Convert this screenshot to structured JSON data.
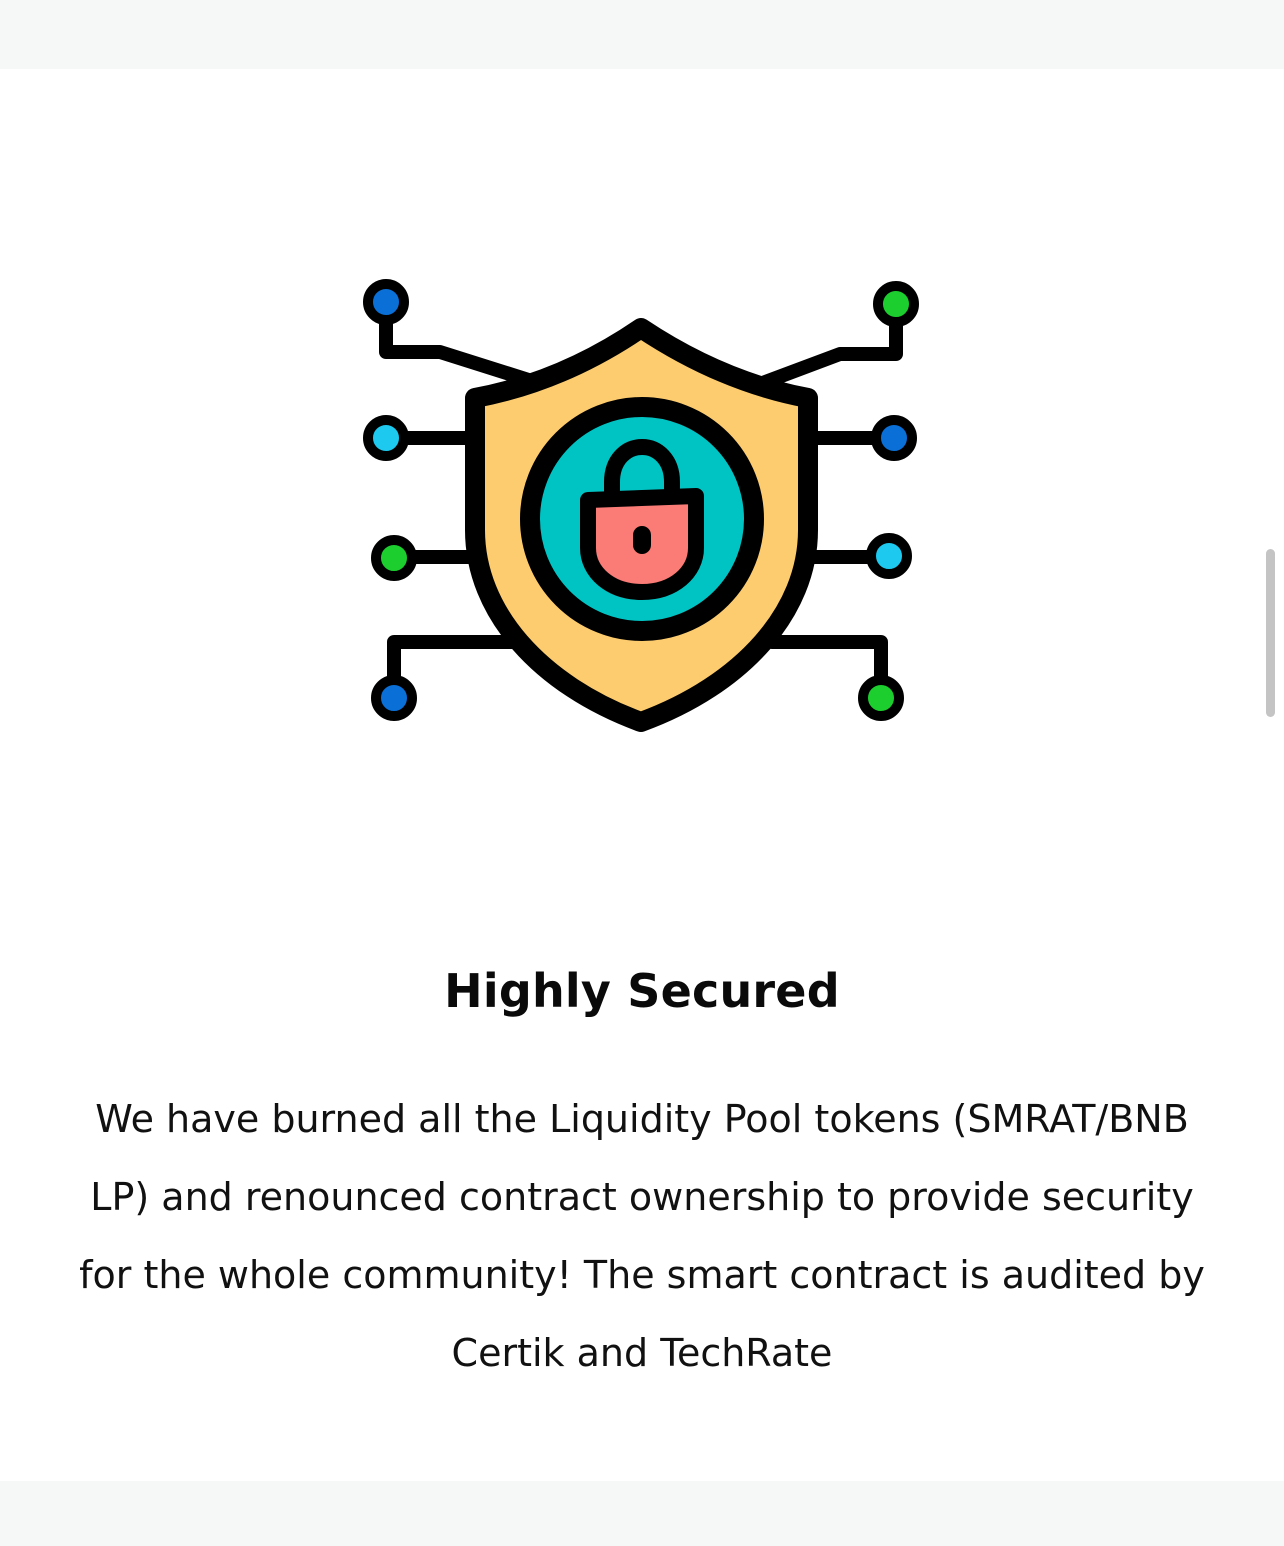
{
  "feature": {
    "title": "Highly Secured",
    "description": "We have burned all the Liquidity Pool tokens (SMRAT/BNB LP) and renounced contract ownership to provide security for the whole community! The smart contract is audited by Certik and TechRate",
    "illustration_icon": "shield-lock-network-icon"
  },
  "colors": {
    "shield_fill": "#fdcc6e",
    "circle_fill": "#00c4c4",
    "lock_fill": "#fb7b76",
    "node_dark_blue": "#0a6fd6",
    "node_light_blue": "#1dc9ee",
    "node_green": "#1ccf2f",
    "outline": "#000000"
  }
}
